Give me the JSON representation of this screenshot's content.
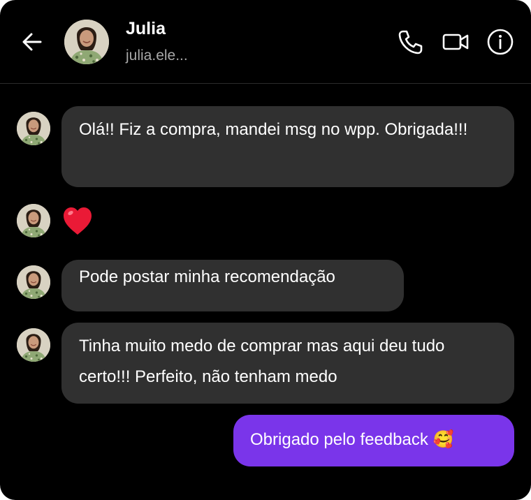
{
  "header": {
    "contact_name": "Julia",
    "contact_handle": "julia.ele...",
    "back_icon": "arrow-left-icon",
    "call_icon": "phone-icon",
    "video_icon": "video-camera-icon",
    "info_icon": "info-icon"
  },
  "messages": [
    {
      "direction": "incoming",
      "text": "Olá!! Fiz a compra, mandei msg no wpp. Obrigada!!!"
    },
    {
      "direction": "incoming",
      "type": "emoji",
      "text": "❤️"
    },
    {
      "direction": "incoming",
      "text": "Pode postar minha recomendação"
    },
    {
      "direction": "incoming",
      "text": "Tinha muito medo de comprar mas aqui deu tudo certo!!! Perfeito, não tenham medo"
    },
    {
      "direction": "outgoing",
      "text": "Obrigado pelo feedback 🥰"
    }
  ],
  "colors": {
    "background": "#000000",
    "incoming_bubble": "#303030",
    "outgoing_bubble": "#7a35ea",
    "text": "#ffffff",
    "secondary_text": "#a8a8a8"
  }
}
